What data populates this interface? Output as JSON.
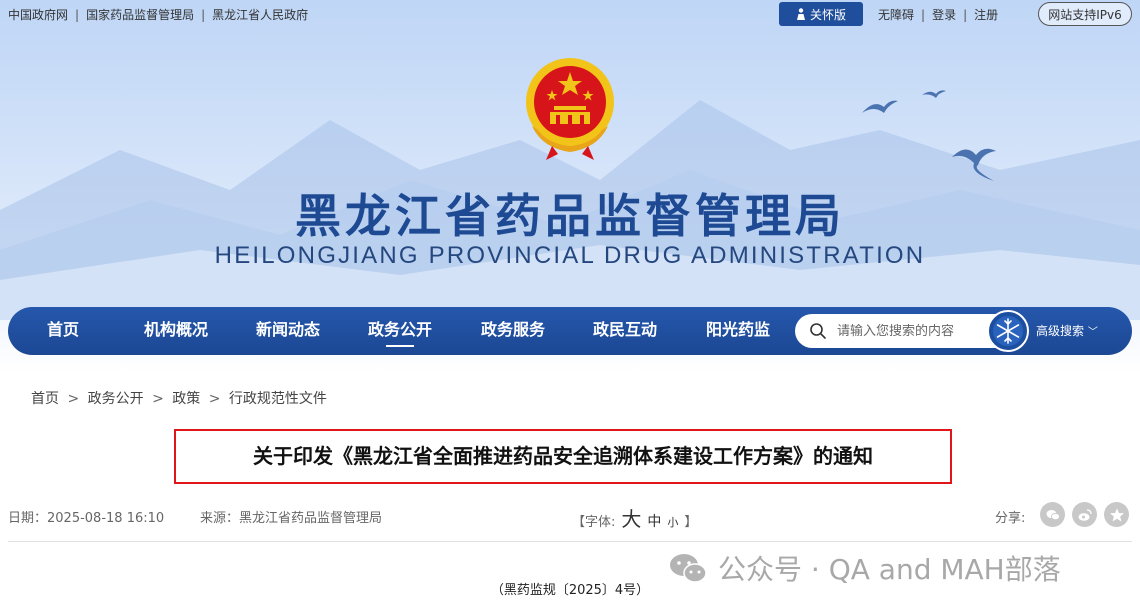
{
  "topbar": {
    "links": [
      "中国政府网",
      "国家药品监督管理局",
      "黑龙江省人民政府"
    ],
    "care_label": "关怀版",
    "accessibility_label": "无障碍",
    "login_label": "登录",
    "register_label": "注册",
    "ipv6_label": "网站支持IPv6"
  },
  "header": {
    "title_cn": "黑龙江省药品监督管理局",
    "title_en": "HEILONGJIANG PROVINCIAL DRUG ADMINISTRATION"
  },
  "nav": {
    "items": [
      {
        "label": "首页"
      },
      {
        "label": "机构概况"
      },
      {
        "label": "新闻动态"
      },
      {
        "label": "政务公开",
        "active": true
      },
      {
        "label": "政务服务"
      },
      {
        "label": "政民互动"
      },
      {
        "label": "阳光药监"
      }
    ],
    "search_placeholder": "请输入您搜索的内容",
    "advanced_search_label": "高级搜索"
  },
  "breadcrumb": {
    "items": [
      "首页",
      "政务公开",
      "政策",
      "行政规范性文件"
    ],
    "separator": ">"
  },
  "article": {
    "title": "关于印发《黑龙江省全面推进药品安全追溯体系建设工作方案》的通知",
    "date_label": "日期：",
    "date": "2025-08-18 16:10",
    "source_label": "来源：",
    "source": "黑龙江省药品监督管理局",
    "font_label": "【字体:",
    "font_big": "大",
    "font_mid": "中",
    "font_small": "小",
    "font_close": "】",
    "share_label": "分享:",
    "doc_number": "（黑药监规〔2025〕4号）"
  },
  "watermark": {
    "text": "公众号 · QA and MAH部落"
  },
  "colors": {
    "nav_blue": "#1f4e9c",
    "title_blue": "#1e4a94",
    "highlight_red": "#e0161b",
    "emblem_red": "#d7141a",
    "emblem_gold": "#f2c318"
  }
}
